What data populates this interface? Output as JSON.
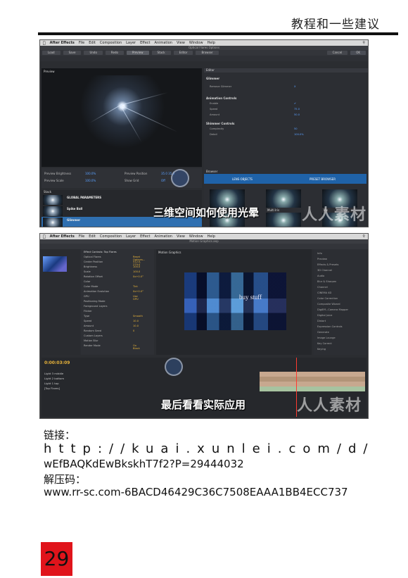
{
  "header": {
    "title": "教程和一些建议"
  },
  "screenshot1": {
    "menubar": {
      "app": "After Effects",
      "menus": [
        "File",
        "Edit",
        "Composition",
        "Layer",
        "Effect",
        "Animation",
        "View",
        "Window",
        "Help"
      ]
    },
    "window_title": "Optical Flares Options",
    "toolbar": [
      "Load",
      "Save",
      "Undo",
      "Redo",
      "Preview",
      "Stack",
      "Editor",
      "Browser",
      "Cancel",
      "OK"
    ],
    "preview_label": "Preview",
    "preview_info": [
      {
        "label": "Preview Brightness",
        "value": "100.0%"
      },
      {
        "label": "Preview Position",
        "value": "35.0  35.0"
      },
      {
        "label": "Preview Scale",
        "value": "100.0%"
      },
      {
        "label": "Show Grid",
        "value": "Off"
      }
    ],
    "stack_label": "Stack",
    "stack_items": [
      {
        "name": "GLOBAL PARAMETERS",
        "selected": false
      },
      {
        "name": "Spike Ball",
        "selected": false
      },
      {
        "name": "Glimmer",
        "selected": true
      }
    ],
    "editor_label": "Editor",
    "editor_item": "Glimmer",
    "editor_props": [
      {
        "label": "Remove Glimmer",
        "value": "X"
      },
      {
        "section": "Animation Controls"
      },
      {
        "label": "Enable",
        "value": "✔"
      },
      {
        "label": "Speed",
        "value": "75.0"
      },
      {
        "label": "Amount",
        "value": "50.0"
      },
      {
        "section": "Shimmer Controls"
      },
      {
        "label": "Complexity",
        "value": "50"
      },
      {
        "label": "Detail",
        "value": "100.0%"
      }
    ],
    "browser_label": "Browser",
    "browser_tabs": [
      "LENS OBJECTS",
      "PRESET BROWSER"
    ],
    "browser_items": [
      "Glow",
      "Multi Iris",
      "Iris"
    ],
    "caption": "三维空间如何使用光晕",
    "watermark": "人人素材"
  },
  "screenshot2": {
    "menubar": {
      "app": "After Effects",
      "menus": [
        "File",
        "Edit",
        "Composition",
        "Layer",
        "Effect",
        "Animation",
        "View",
        "Window",
        "Help"
      ]
    },
    "window_title": "Motion Graphics.aep",
    "comp_name": "Motion Graphics",
    "comp_text": "buy stuff",
    "effects_title": "Effect Controls: Top Flares",
    "effects": [
      {
        "label": "Optical Flares",
        "value": "Reset  Options..."
      },
      {
        "label": "Center Position",
        "value": "512.0, 279.0"
      },
      {
        "label": "Brightness",
        "value": "100.0"
      },
      {
        "label": "Scale",
        "value": "100.0"
      },
      {
        "label": "Rotation Offset",
        "value": "0x+0.0°"
      },
      {
        "label": "Color",
        "value": ""
      },
      {
        "label": "Color Mode",
        "value": "Tint"
      },
      {
        "label": "Animation Evolution",
        "value": "0x+0.0°"
      },
      {
        "label": "GPU",
        "value": "Use GPU"
      },
      {
        "label": "Positioning Mode",
        "value": ""
      },
      {
        "label": "Foreground Layers",
        "value": ""
      },
      {
        "label": "Flicker",
        "value": ""
      },
      {
        "label": "Type",
        "value": "Smooth"
      },
      {
        "label": "Speed",
        "value": "10.0"
      },
      {
        "label": "Amount",
        "value": "10.0"
      },
      {
        "label": "Random Seed",
        "value": "0"
      },
      {
        "label": "Custom Layers",
        "value": ""
      },
      {
        "label": "Motion Blur",
        "value": ""
      },
      {
        "label": "Render Mode",
        "value": "On Black"
      }
    ],
    "right_panel": [
      "Info",
      "Preview",
      "Effects & Presets",
      "3D Channel",
      "Audio",
      "Blur & Sharpen",
      "Channel",
      "CINEMA 4D",
      "Color Correction",
      "Composite Wizard",
      "DigiEff...Camera Mapper",
      "Digital Juice",
      "Distort",
      "Expression Controls",
      "Generate",
      "Image Lounge",
      "Key Correct",
      "Keying"
    ],
    "timecode": "0:00:03:09",
    "layers": [
      "Light 3 middle",
      "Light 2 bottom",
      "Light 1 top",
      "[Top Flares]"
    ],
    "caption": "最后看看实际应用",
    "watermark": "人人素材"
  },
  "download": {
    "link_label": "链接：",
    "url_line1": "http://kuai.xunlei.com/d/",
    "url_line2": "wEfBAQKdEwBkskhT7f2?P=29444032",
    "password_label": "解压码：",
    "password": "www.rr-sc.com-6BACD46429C36C7508EAAA1BB4ECC737"
  },
  "page_number": "29",
  "colors": {
    "page_badge": "#e0141b",
    "accent_blue": "#2f6fb0",
    "timecode": "#e9b43a"
  }
}
